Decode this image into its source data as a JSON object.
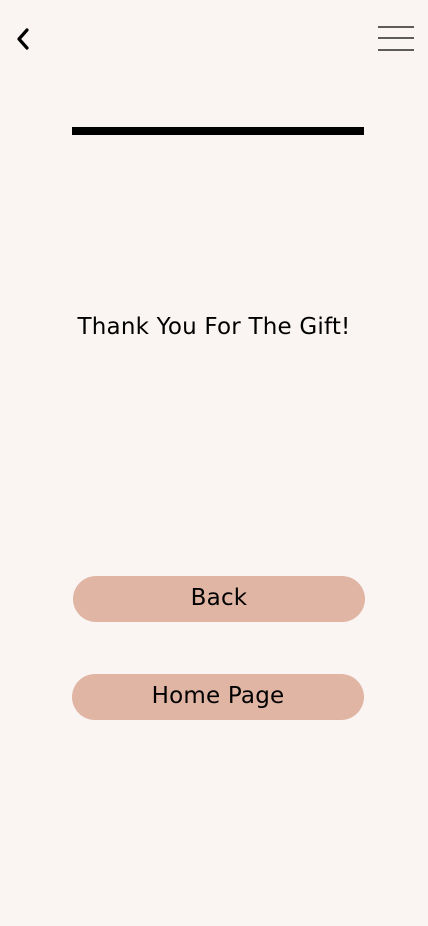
{
  "header": {
    "back_icon": "chevron-left-icon",
    "menu_icon": "hamburger-menu-icon"
  },
  "main": {
    "message": "Thank You For The Gift!"
  },
  "actions": {
    "back_label": "Back",
    "home_label": "Home Page"
  },
  "colors": {
    "background": "#faf5f3",
    "button": "#e0b5a3",
    "text": "#000000"
  }
}
